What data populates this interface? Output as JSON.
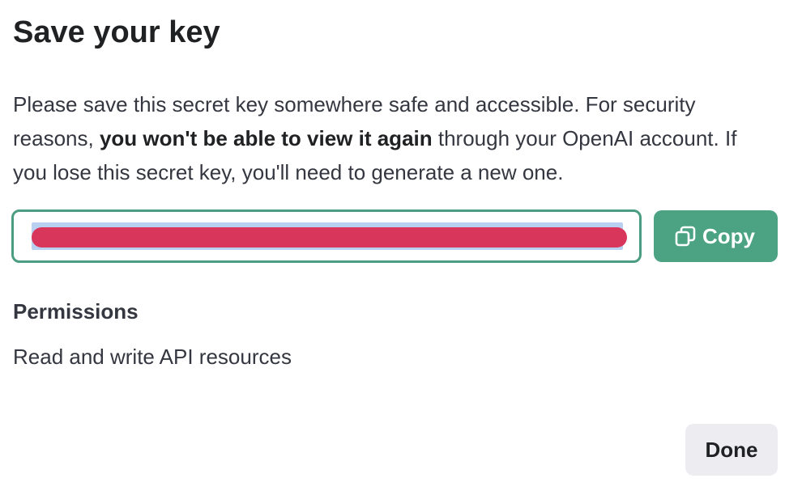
{
  "dialog": {
    "title": "Save your key",
    "description": {
      "part1": "Please save this secret key somewhere safe and accessible. For security reasons, ",
      "bold": "you won't be able to view it again",
      "part2": " through your OpenAI account. If you lose this secret key, you'll need to generate a new one."
    },
    "key_field": {
      "value": "",
      "redacted": true
    },
    "copy_button": {
      "label": "Copy",
      "icon": "copy-icon"
    },
    "permissions": {
      "heading": "Permissions",
      "value": "Read and write API resources"
    },
    "done_button": {
      "label": "Done"
    }
  },
  "colors": {
    "accent": "#4ba384",
    "field_border": "#4a9d82",
    "redaction": "#d9365c",
    "selection": "#b9d1f1",
    "secondary_button": "#ececf1",
    "text": "#202123"
  }
}
